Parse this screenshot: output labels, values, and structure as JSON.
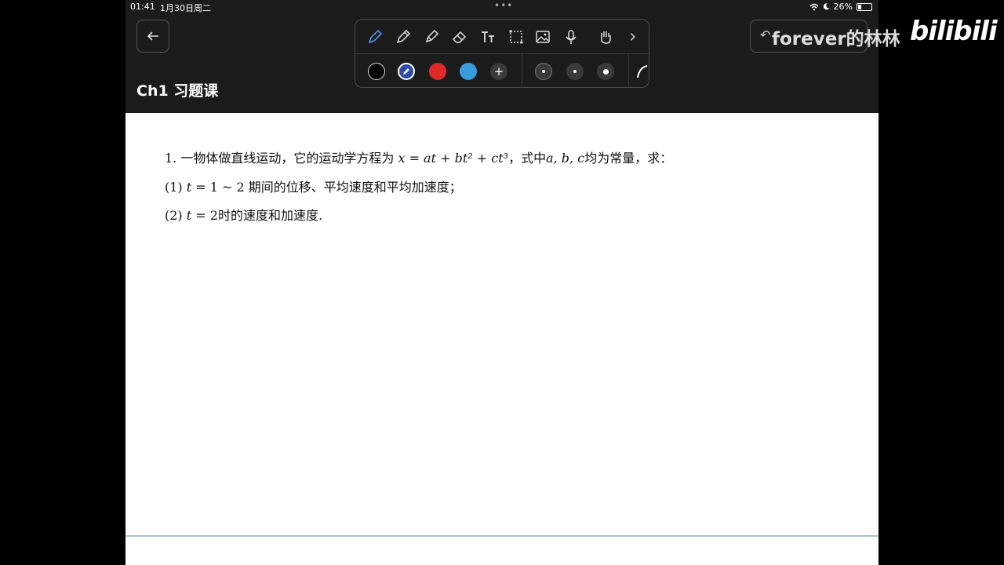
{
  "status": {
    "time": "01:41",
    "date": "1月30日周二",
    "dots": "•••",
    "battery": "26%",
    "battery_level": 0.26
  },
  "toolbar": {
    "tools": [
      "pen-icon",
      "pencil-icon",
      "highlighter-icon",
      "eraser-icon",
      "text-icon",
      "lasso-select-icon",
      "image-icon",
      "microphone-icon",
      "hand-icon",
      "chevron-right-icon"
    ],
    "colors": [
      "#000000",
      "#2e4aa8",
      "#e02a2a",
      "#3a9bdc"
    ],
    "add_label": "+",
    "more_label": ">"
  },
  "document": {
    "title": "Ch1 习题课",
    "q1_prefix": "1. 一物体做直线运动，它的运动学方程为 ",
    "q1_eq": "x = at + bt² + ct³",
    "q1_mid": "，式中",
    "q1_vars": "a, b, c",
    "q1_suffix": "均为常量，求：",
    "q1a_prefix": "(1) ",
    "q1a_var": "t",
    "q1a_rest": " = 1 ~ 2 期间的位移、平均速度和平均加速度；",
    "q1b_prefix": "(2) ",
    "q1b_var": "t",
    "q1b_rest": " = 2时的速度和加速度."
  },
  "watermark": {
    "text": "forever的林林",
    "brand": "bilibili"
  }
}
